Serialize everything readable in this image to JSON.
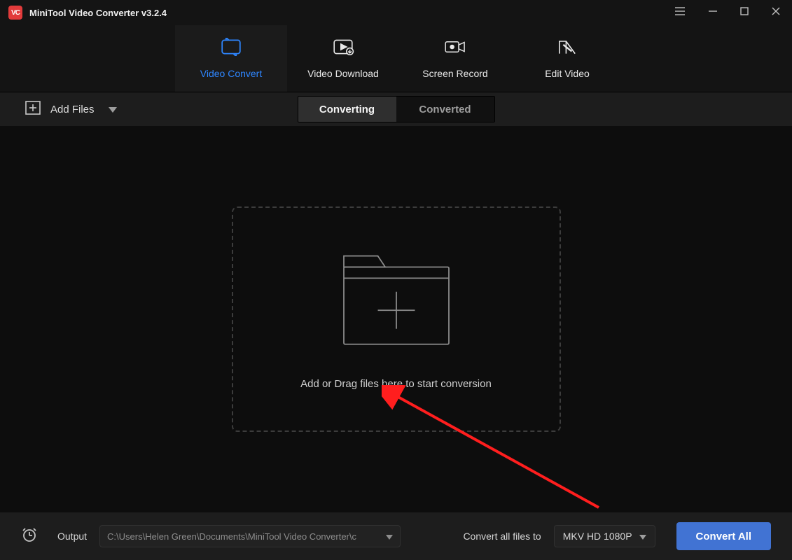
{
  "window": {
    "title": "MiniTool Video Converter v3.2.4"
  },
  "tabs": {
    "video_convert": "Video Convert",
    "video_download": "Video Download",
    "screen_record": "Screen Record",
    "edit_video": "Edit Video"
  },
  "subbar": {
    "add_files": "Add Files",
    "converting": "Converting",
    "converted": "Converted"
  },
  "dropzone": {
    "text": "Add or Drag files here to start conversion"
  },
  "footer": {
    "output_label": "Output",
    "output_path": "C:\\Users\\Helen Green\\Documents\\MiniTool Video Converter\\c",
    "convert_all_label": "Convert all files to",
    "output_format": "MKV HD 1080P",
    "convert_all_btn": "Convert All"
  }
}
